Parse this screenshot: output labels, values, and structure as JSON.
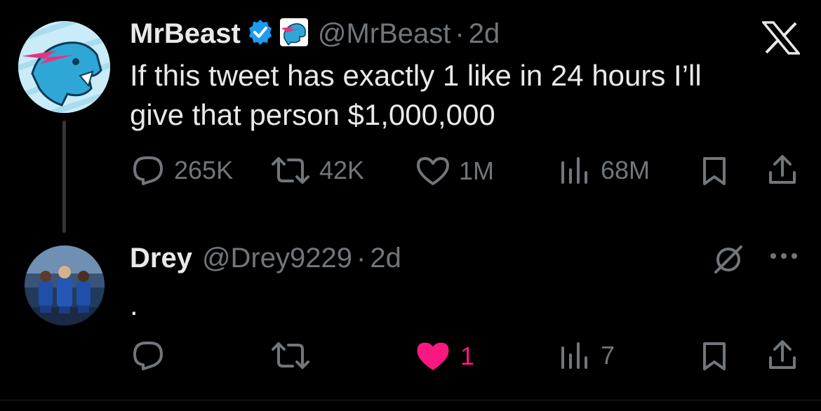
{
  "tweet": {
    "author_name": "MrBeast",
    "handle": "@MrBeast",
    "time": "2d",
    "text_line1": "If this tweet has exactly 1 like in 24 hours I’ll",
    "text_line2": "give that person $1,000,000",
    "replies": "265K",
    "reposts": "42K",
    "likes": "1M",
    "views": "68M",
    "verified": true
  },
  "reply": {
    "author_name": "Drey",
    "handle": "@Drey9229",
    "time": "2d",
    "text": ".",
    "likes": "1",
    "views": "7",
    "liked": true
  },
  "colors": {
    "background": "#000000",
    "text": "#e7e9ea",
    "secondary": "#71767b",
    "verified": "#1d9bf0",
    "like_active": "#f91880",
    "thread_line": "#333639"
  },
  "icons": [
    "reply-icon",
    "repost-icon",
    "like-icon",
    "views-icon",
    "bookmark-icon",
    "share-icon",
    "x-logo-icon",
    "verified-badge-icon",
    "mute-icon",
    "more-icon"
  ]
}
